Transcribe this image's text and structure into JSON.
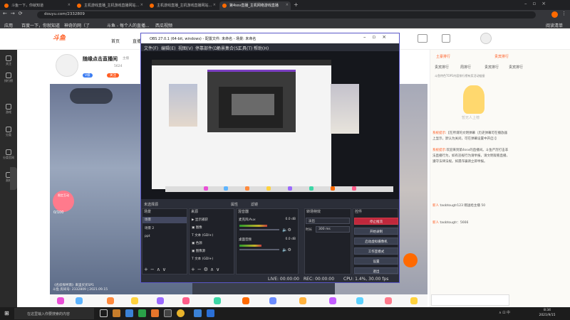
{
  "browser": {
    "tabs": [
      {
        "label": "斗鱼一下，你就知道"
      },
      {
        "label": "主机游戏直播_主机游戏直播网站..."
      },
      {
        "label": "主机游戏直播_主机游戏直播网站..."
      },
      {
        "label": "第4ssv直播_主机网络游戏直播"
      }
    ],
    "url": "douyu.com/2332809",
    "bookmarks": [
      "应用",
      "百度一下，你就知道",
      "神奇的网（了",
      "斗鱼 - 每个人的直播...",
      "西瓜视频"
    ],
    "reading_list": "阅读清单"
  },
  "douyu": {
    "logo": "斗鱼",
    "nav": [
      "首页",
      "直播"
    ],
    "leftbar": [
      "关注",
      "排行榜",
      "游戏",
      "分类",
      "分类官网",
      "直播"
    ],
    "room": {
      "title": "随缘点击直播间",
      "streamer_tag": "主播",
      "level": "V级",
      "follow": "关注",
      "watch": "5624",
      "live_badge": "限定互动",
      "live_count": "0/100",
      "info_line1": "《名侦探柯南》来里买买SP1",
      "info_line2": "斗鱼 房间号: 2332809 | 2021.09.15"
    },
    "right": {
      "tab1": "土豪排行",
      "tab2": "贵宾排行",
      "sub_tabs": [
        "贵宾排行",
        "周排行",
        "贵宾排行",
        "贵宾排行"
      ],
      "notice": "斗鱼特色TOP3内容排行榜有奖活动链接",
      "mascot_text": "暂无人上榜",
      "chat": [
        {
          "who": "系统提示:",
          "text": "【在所谓的文明弹幕（历史弹幕可在播放器上显示，默认为关闭，可在弹幕设置中开启）】"
        },
        {
          "who": "系统提示:",
          "text": "欢迎来到第4ssv的直播间。斗鱼严厉打击非法直播行为，如有违规行为请举报，请文明观看直播，遵守法律法规。如遇诈骗请立即举报。"
        },
        {
          "who": "新人",
          "text": "taobtougtr123  赠送给主播 50"
        },
        {
          "who": "新人",
          "text": "taobtougtr：5666"
        }
      ]
    }
  },
  "obs": {
    "title": "OBS 27.0.1 (64-bit, windows) - 配置文件: 未命名 - 场景: 未命名",
    "menu": [
      "文件(F)",
      "编辑(E)",
      "视图(V)",
      "停靠部件(D)",
      "配置文件(P)",
      "场景集合(S)",
      "工具(T)",
      "帮助(H)"
    ],
    "tools_label": "未选择源",
    "tools": [
      "属性",
      "滤镜"
    ],
    "docks": {
      "scenes": "场景",
      "sources": "来源",
      "mixer": "混音器",
      "transitions": "转场特效",
      "controls": "控件"
    },
    "scenes": [
      "场景",
      "场景 2",
      "ppt"
    ],
    "sources": [
      "显示捕获",
      "图像",
      "文本 (GDI+)",
      "色源",
      "图像源",
      "文本 (GDI+)"
    ],
    "mixer": [
      {
        "name": "麦克风/Aux",
        "db": "0.0 dB",
        "level": 0.7
      },
      {
        "name": "桌面音频",
        "db": "0.0 dB",
        "level": 0.55
      }
    ],
    "transition": {
      "type": "淡出",
      "duration_label": "时长",
      "duration": "300 ms"
    },
    "controls": [
      "停止推流",
      "开始录制",
      "启动虚拟摄像机",
      "工作室模式",
      "设置",
      "退出"
    ],
    "status": {
      "live": "LIVE: 00:00:00",
      "rec": "REC: 00:00:00",
      "cpu": "CPU: 1.4%, 30.00 fps"
    }
  },
  "taskbar": {
    "search": "在这里输入你要搜索的内容",
    "time": "8:34",
    "date": "2021/9/15",
    "tray": "∧ ⊡ 中"
  }
}
